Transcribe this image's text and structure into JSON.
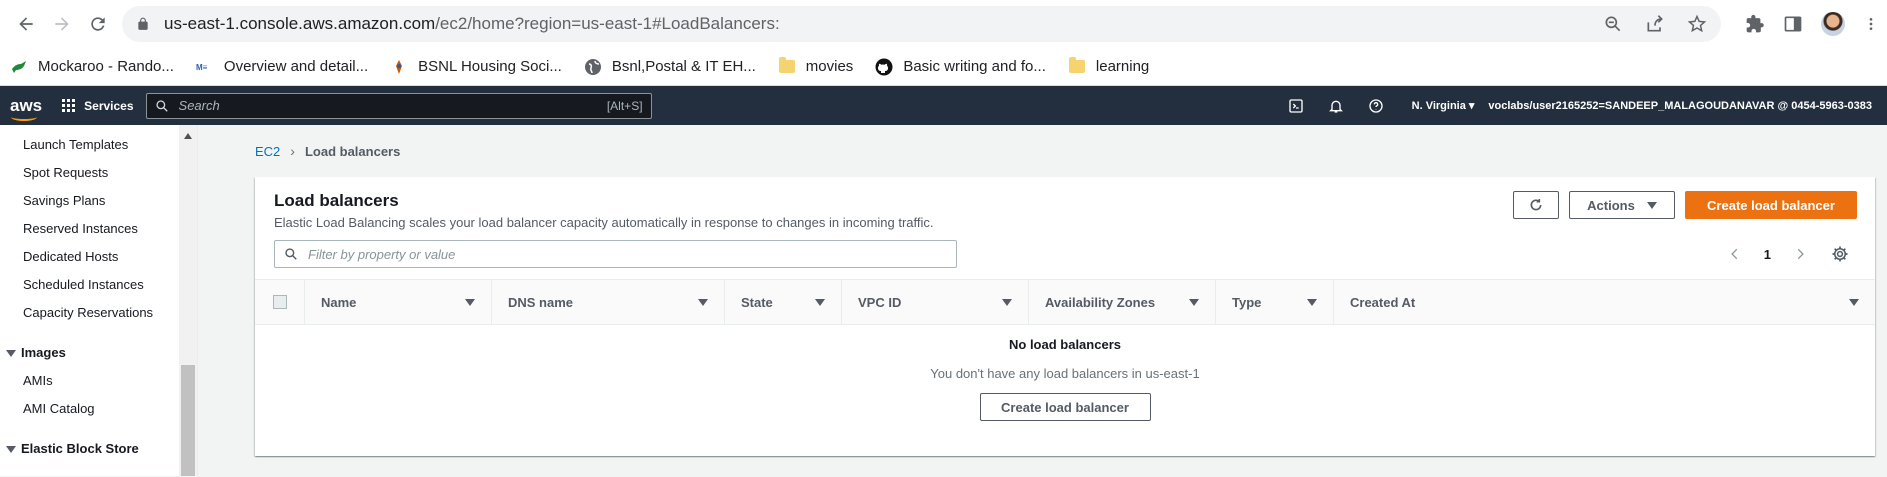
{
  "browser": {
    "url_host": "us-east-1.console.aws.amazon.com",
    "url_path": "/ec2/home?region=us-east-1#LoadBalancers:",
    "bookmarks": [
      {
        "label": "Mockaroo - Rando...",
        "icon": "mockaroo-icon"
      },
      {
        "label": "Overview and detail...",
        "icon": "site-icon"
      },
      {
        "label": "BSNL Housing Soci...",
        "icon": "site-icon"
      },
      {
        "label": "Bsnl,Postal & IT EH...",
        "icon": "globe-icon"
      },
      {
        "label": "movies",
        "icon": "folder-icon"
      },
      {
        "label": "Basic writing and fo...",
        "icon": "github-icon"
      },
      {
        "label": "learning",
        "icon": "folder-icon"
      }
    ]
  },
  "aws": {
    "logo": "aws",
    "services_label": "Services",
    "search_placeholder": "Search",
    "search_shortcut": "[Alt+S]",
    "region": "N. Virginia",
    "account": "voclabs/user2165252=SANDEEP_MALAGOUDANAVAR @ 0454-5963-0383"
  },
  "sidebar": {
    "items": [
      "Launch Templates",
      "Spot Requests",
      "Savings Plans",
      "Reserved Instances",
      "Dedicated Hosts",
      "Scheduled Instances",
      "Capacity Reservations"
    ],
    "sections": [
      {
        "label": "Images",
        "items": [
          "AMIs",
          "AMI Catalog"
        ]
      },
      {
        "label": "Elastic Block Store",
        "items": []
      }
    ]
  },
  "breadcrumb": {
    "root": "EC2",
    "current": "Load balancers"
  },
  "panel": {
    "title": "Load balancers",
    "description": "Elastic Load Balancing scales your load balancer capacity automatically in response to changes in incoming traffic.",
    "actions_label": "Actions",
    "create_label": "Create load balancer",
    "filter_placeholder": "Filter by property or value",
    "page_number": "1",
    "columns": [
      "Name",
      "DNS name",
      "State",
      "VPC ID",
      "Availability Zones",
      "Type",
      "Created At"
    ],
    "empty_title": "No load balancers",
    "empty_subtitle": "You don't have any load balancers in us-east-1",
    "empty_button": "Create load balancer"
  },
  "colors": {
    "aws_nav": "#232f3e",
    "primary": "#ec7211",
    "link": "#0073bb"
  }
}
